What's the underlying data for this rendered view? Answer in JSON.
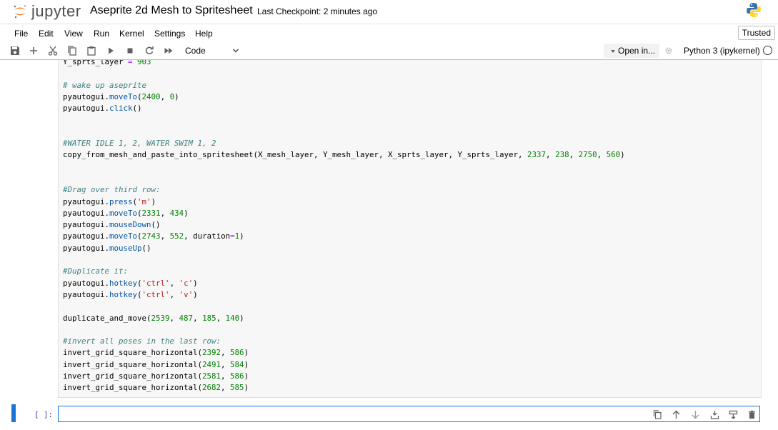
{
  "header": {
    "logo_text": "jupyter",
    "notebook_title": "Aseprite 2d Mesh to Spritesheet",
    "checkpoint": "Last Checkpoint: 2 minutes ago"
  },
  "menu": {
    "items": [
      "File",
      "Edit",
      "View",
      "Run",
      "Kernel",
      "Settings",
      "Help"
    ],
    "trusted": "Trusted"
  },
  "toolbar": {
    "cell_type": "Code",
    "open_in": "Open in...",
    "kernel": "Python 3 (ipykernel)",
    "icons": [
      "save-icon",
      "add-icon",
      "cut-icon",
      "copy-icon",
      "paste-icon",
      "run-icon",
      "stop-icon",
      "restart-icon",
      "fast-forward-icon"
    ]
  },
  "cell": {
    "empty_prompt": "[ ]:",
    "toolbar_icons": [
      "duplicate-icon",
      "move-up-icon",
      "move-down-icon",
      "insert-above-icon",
      "insert-below-icon",
      "delete-icon"
    ]
  },
  "colors": {
    "accent": "#1976d2",
    "comment": "#408080",
    "number": "#008000",
    "string": "#ba2121",
    "function": "#0055aa",
    "operator": "#aa22ff",
    "logo_orange": "#f37726"
  },
  "code_lines": [
    "Y_sprts_layer = 903",
    "",
    "# wake up aseprite",
    "pyautogui.moveTo(2400, 0)",
    "pyautogui.click()",
    "",
    "",
    "#WATER IDLE 1, 2, WATER SWIM 1, 2",
    "copy_from_mesh_and_paste_into_spritesheet(X_mesh_layer, Y_mesh_layer, X_sprts_layer, Y_sprts_layer, 2337, 238, 2750, 560)",
    "",
    "",
    "#Drag over third row:",
    "pyautogui.press('m')",
    "pyautogui.moveTo(2331, 434)",
    "pyautogui.mouseDown()",
    "pyautogui.moveTo(2743, 552, duration=1)",
    "pyautogui.mouseUp()",
    "",
    "#Duplicate it:",
    "pyautogui.hotkey('ctrl', 'c')",
    "pyautogui.hotkey('ctrl', 'v')",
    "",
    "duplicate_and_move(2539, 487, 185, 140)",
    "",
    "#invert all poses in the last row:",
    "invert_grid_square_horizontal(2392, 586)",
    "invert_grid_square_horizontal(2491, 584)",
    "invert_grid_square_horizontal(2581, 586)",
    "invert_grid_square_horizontal(2682, 585)"
  ]
}
